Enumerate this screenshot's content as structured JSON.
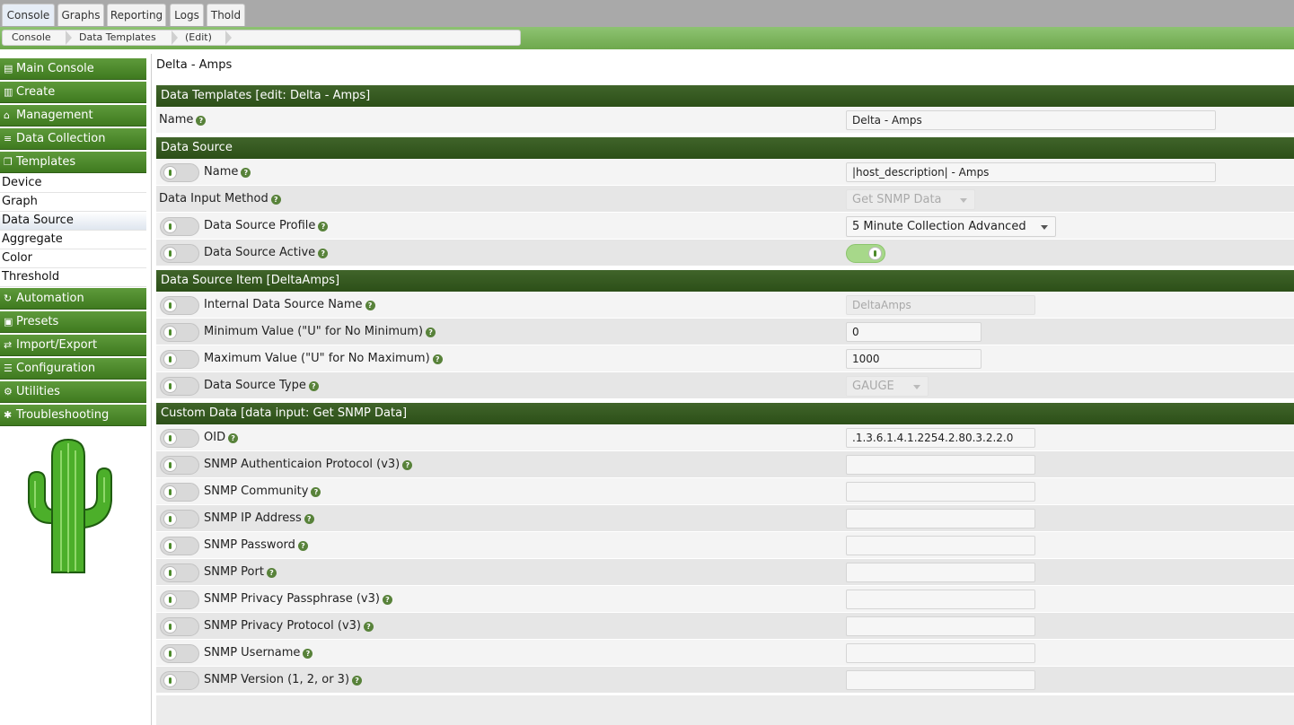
{
  "tabs": [
    "Console",
    "Graphs",
    "Reporting",
    "Logs",
    "Thold"
  ],
  "breadcrumb": [
    "Console",
    "Data Templates",
    "(Edit)"
  ],
  "sidebar": {
    "menus": [
      {
        "label": "Main Console",
        "icon": "map-icon"
      },
      {
        "label": "Create",
        "icon": "chart-icon"
      },
      {
        "label": "Management",
        "icon": "home-icon"
      },
      {
        "label": "Data Collection",
        "icon": "database-icon"
      },
      {
        "label": "Templates",
        "icon": "copy-icon"
      },
      {
        "label": "Automation",
        "icon": "refresh-icon"
      },
      {
        "label": "Presets",
        "icon": "archive-icon"
      },
      {
        "label": "Import/Export",
        "icon": "exchange-icon"
      },
      {
        "label": "Configuration",
        "icon": "sliders-icon"
      },
      {
        "label": "Utilities",
        "icon": "gears-icon"
      },
      {
        "label": "Troubleshooting",
        "icon": "bug-icon"
      }
    ],
    "template_items": [
      "Device",
      "Graph",
      "Data Source",
      "Aggregate",
      "Color",
      "Threshold"
    ],
    "selected_item": "Data Source"
  },
  "page": {
    "title": "Delta - Amps",
    "sections": {
      "templates": "Data Templates [edit: Delta - Amps]",
      "data_source": "Data Source",
      "item": "Data Source Item [DeltaAmps]",
      "custom": "Custom Data [data input: Get SNMP Data]"
    }
  },
  "template_name": {
    "label": "Name",
    "value": "Delta - Amps"
  },
  "data_source": {
    "name": {
      "label": "Name",
      "value": "|host_description| - Amps"
    },
    "input_method": {
      "label": "Data Input Method",
      "value": "Get SNMP Data"
    },
    "profile": {
      "label": "Data Source Profile",
      "value": "5 Minute Collection Advanced"
    },
    "active": {
      "label": "Data Source Active",
      "on": true
    }
  },
  "item": {
    "internal_name": {
      "label": "Internal Data Source Name",
      "value": "DeltaAmps"
    },
    "min": {
      "label": "Minimum Value (\"U\" for No Minimum)",
      "value": "0"
    },
    "max": {
      "label": "Maximum Value (\"U\" for No Maximum)",
      "value": "1000"
    },
    "type": {
      "label": "Data Source Type",
      "value": "GAUGE"
    }
  },
  "custom": [
    {
      "label": "OID",
      "value": ".1.3.6.1.4.1.2254.2.80.3.2.2.0"
    },
    {
      "label": "SNMP Authenticaion Protocol (v3)",
      "value": ""
    },
    {
      "label": "SNMP Community",
      "value": ""
    },
    {
      "label": "SNMP IP Address",
      "value": ""
    },
    {
      "label": "SNMP Password",
      "value": ""
    },
    {
      "label": "SNMP Port",
      "value": ""
    },
    {
      "label": "SNMP Privacy Passphrase (v3)",
      "value": ""
    },
    {
      "label": "SNMP Privacy Protocol (v3)",
      "value": ""
    },
    {
      "label": "SNMP Username",
      "value": ""
    },
    {
      "label": "SNMP Version (1, 2, or 3)",
      "value": ""
    }
  ],
  "help_glyph": "?",
  "colors": {
    "brand": "#3f7a1f",
    "band": "#2c4f18",
    "toggle_on": "#a7d88a"
  }
}
